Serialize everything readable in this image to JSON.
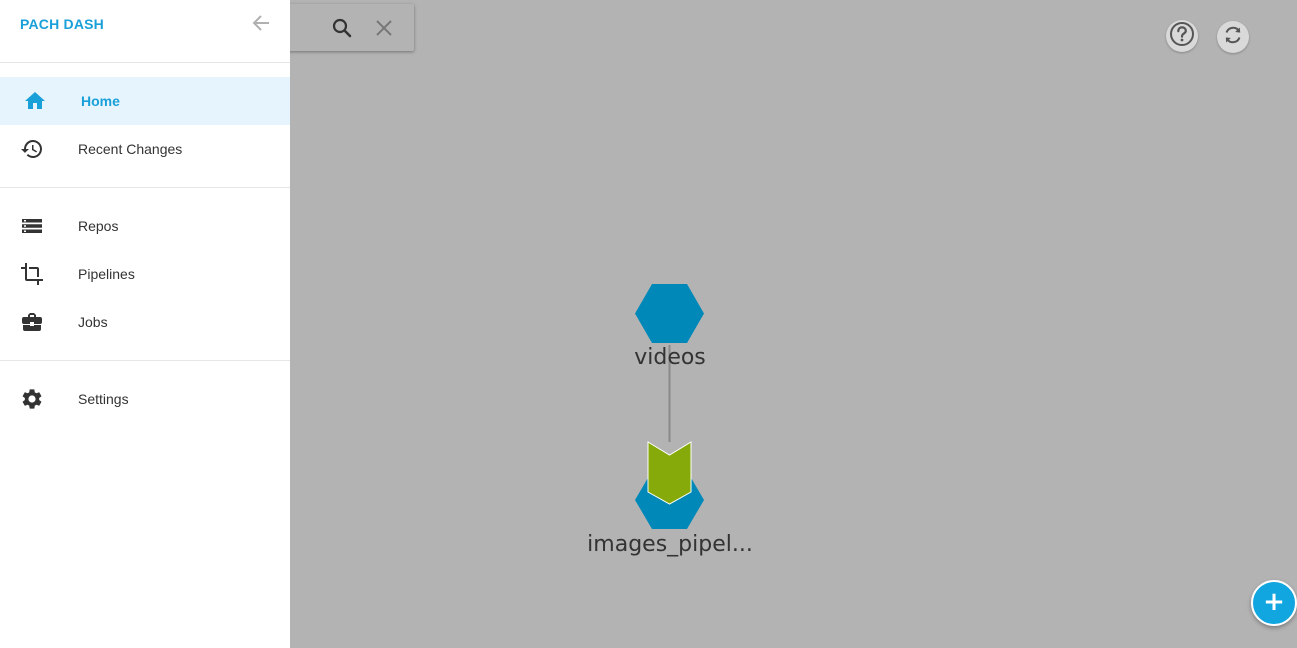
{
  "app": {
    "brand": "PACH DASH"
  },
  "nav": {
    "primary": [
      {
        "label": "Home",
        "icon": "home-icon",
        "active": true
      },
      {
        "label": "Recent Changes",
        "icon": "history-icon",
        "active": false
      }
    ],
    "secondary": [
      {
        "label": "Repos",
        "icon": "list-icon"
      },
      {
        "label": "Pipelines",
        "icon": "crop-icon"
      },
      {
        "label": "Jobs",
        "icon": "briefcase-icon"
      }
    ],
    "settings": {
      "label": "Settings",
      "icon": "gear-icon"
    }
  },
  "toolbar": {
    "search_icon": "search-icon",
    "clear_icon": "close-icon",
    "help_icon": "help-icon",
    "refresh_icon": "refresh-icon",
    "add_icon": "plus-icon"
  },
  "graph": {
    "nodes": [
      {
        "name": "videos",
        "type": "repo"
      },
      {
        "name": "images_pipel...",
        "type": "pipeline"
      }
    ],
    "edges": [
      {
        "from": "videos",
        "to": "images_pipel..."
      }
    ]
  },
  "colors": {
    "accent": "#1aa0d8",
    "repo_node": "#0088b8",
    "pipeline_node": "#86aa0a",
    "backdrop": "#b3b3b3",
    "fab": "#12a6e0"
  }
}
